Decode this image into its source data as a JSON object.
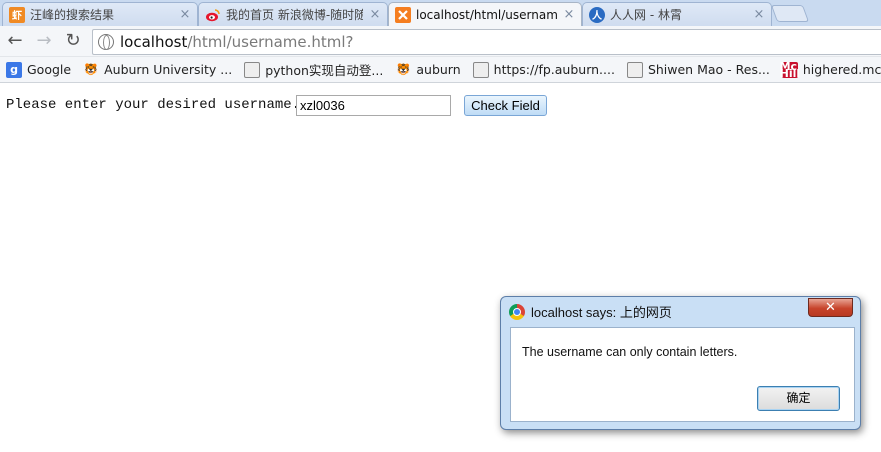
{
  "tabs": [
    {
      "title": "汪峰的搜索结果",
      "favicon": "xiami-icon",
      "color": "#f08a24",
      "glyph": "虾",
      "active": false
    },
    {
      "title": "我的首页 新浪微博-随时随",
      "favicon": "weibo-icon",
      "color": "#e6162d",
      "glyph": "",
      "active": false
    },
    {
      "title": "localhost/html/username",
      "favicon": "xampp-icon",
      "color": "#f57e20",
      "glyph": "",
      "active": true
    },
    {
      "title": "人人网 - 林霄",
      "favicon": "renren-icon",
      "color": "#2a6bc2",
      "glyph": "",
      "active": false
    }
  ],
  "toolbar": {
    "back_icon": "←",
    "forward_icon": "→",
    "reload_icon": "↻",
    "url_host": "localhost",
    "url_path": "/html/username.html?"
  },
  "bookmarks": [
    {
      "label": "Google",
      "icon": "google-icon"
    },
    {
      "label": "Auburn University ...",
      "icon": "tiger-icon"
    },
    {
      "label": "python实现自动登...",
      "icon": "globe-icon"
    },
    {
      "label": "auburn",
      "icon": "tiger-icon"
    },
    {
      "label": "https://fp.auburn....",
      "icon": "globe-icon"
    },
    {
      "label": "Shiwen Mao - Res...",
      "icon": "globe-icon"
    },
    {
      "label": "highered.mcgraw-",
      "icon": "mcgraw-icon"
    }
  ],
  "page": {
    "prompt": "Please enter your desired username.",
    "username_value": "xzl0036",
    "check_button": "Check Field"
  },
  "dialog": {
    "title": "localhost says: 上的网页",
    "message": "The username can only contain letters.",
    "ok_button": "确定",
    "close_glyph": "✕"
  }
}
